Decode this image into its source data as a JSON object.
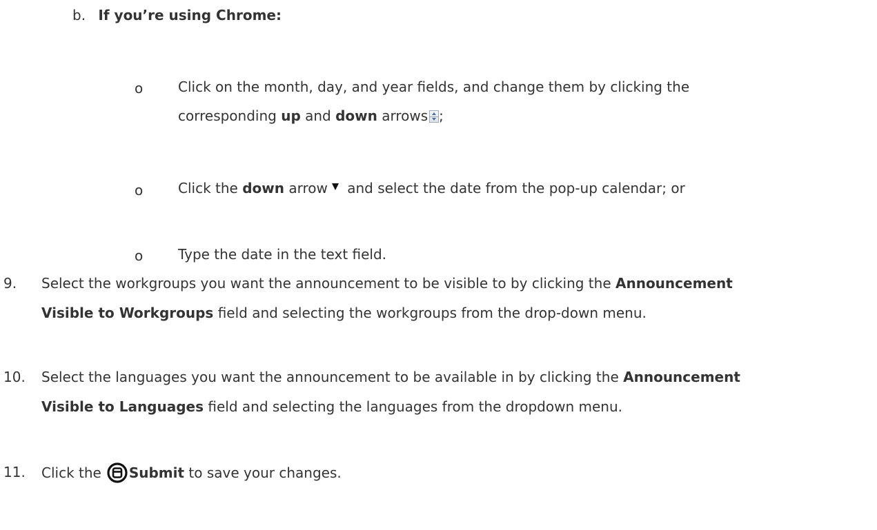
{
  "sub_b": {
    "marker": "b.",
    "text": "If you’re using Chrome:"
  },
  "bullets": {
    "marker": "o",
    "b1": {
      "t1": "Click on the month, day, and year fields, and change them by clicking the",
      "t2a": "corresponding ",
      "up": "up",
      "t2b": " and ",
      "down": "down",
      "t2c": " arrows",
      "t2d": ";"
    },
    "b2": {
      "t1": "Click the ",
      "down": "down",
      "t2": " arrow",
      "t3": " and select the date from the pop-up calendar; or"
    },
    "b3": {
      "t1": "Type the date in the text field."
    }
  },
  "step9": {
    "num": "9.",
    "t1": "Select the workgroups you want the announcement to be visible to by clicking the ",
    "b1": "Announcement",
    "b2": "Visible to Workgroups",
    "t2": " field and selecting the workgroups from the drop-down menu."
  },
  "step10": {
    "num": "10.",
    "t1": "Select the languages you want the announcement to be available in by clicking the ",
    "b1": "Announcement",
    "b2": "Visible to Languages",
    "t2": " field and selecting the languages from the dropdown menu."
  },
  "step11": {
    "num": "11.",
    "t1": "Click the",
    "b1": "Submit",
    "t2": " to save your changes."
  },
  "icons": {
    "spinner": "spin-arrows-icon",
    "dropdown": "triangle-down-icon",
    "submit": "save-circle-icon"
  }
}
